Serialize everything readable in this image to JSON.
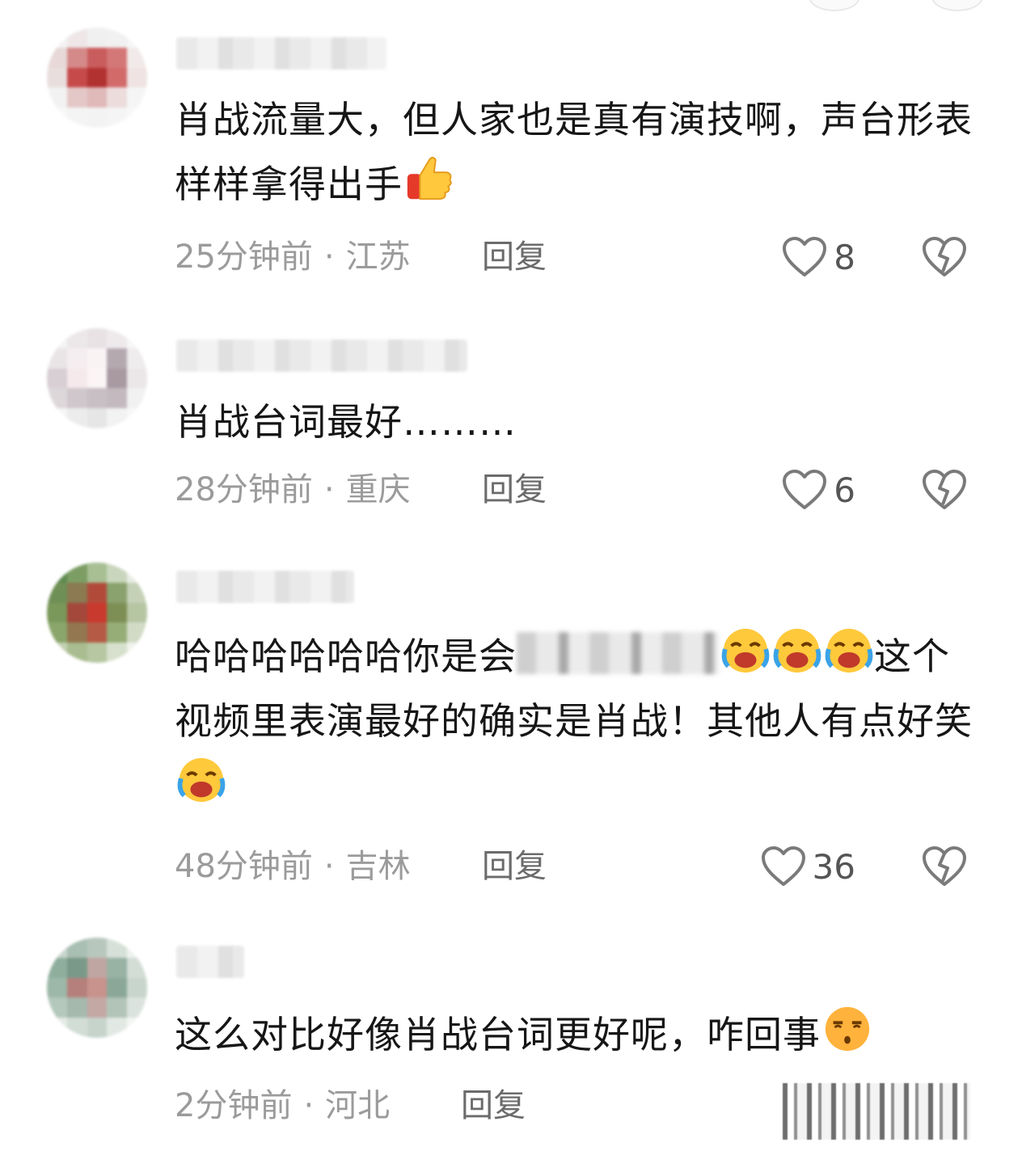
{
  "comments": [
    {
      "text": "肖战流量大，但人家也是真有演技啊，声台形表样样拿得出手",
      "emoji": "thumbs-up",
      "time": "25分钟前",
      "separator": "·",
      "location": "江苏",
      "reply_label": "回复",
      "likes": "8"
    },
    {
      "text": "肖战台词最好………",
      "time": "28分钟前",
      "separator": "·",
      "location": "重庆",
      "reply_label": "回复",
      "likes": "6"
    },
    {
      "text_before": "哈哈哈哈哈哈你是会",
      "text_after": "这个视频里表演最好的确实是肖战！其他人有点好笑",
      "emoji": "laughing-crying",
      "time": "48分钟前",
      "separator": "·",
      "location": "吉林",
      "reply_label": "回复",
      "likes": "36"
    },
    {
      "text": "这么对比好像肖战台词更好呢，咋回事",
      "emoji": "unamused-face",
      "time": "2分钟前",
      "separator": "·",
      "location": "河北",
      "reply_label": "回复"
    }
  ],
  "colors": {
    "text": "#161616",
    "meta": "#9b9b9b",
    "reply": "#6b6b6b",
    "icon": "#7a7a7a"
  }
}
